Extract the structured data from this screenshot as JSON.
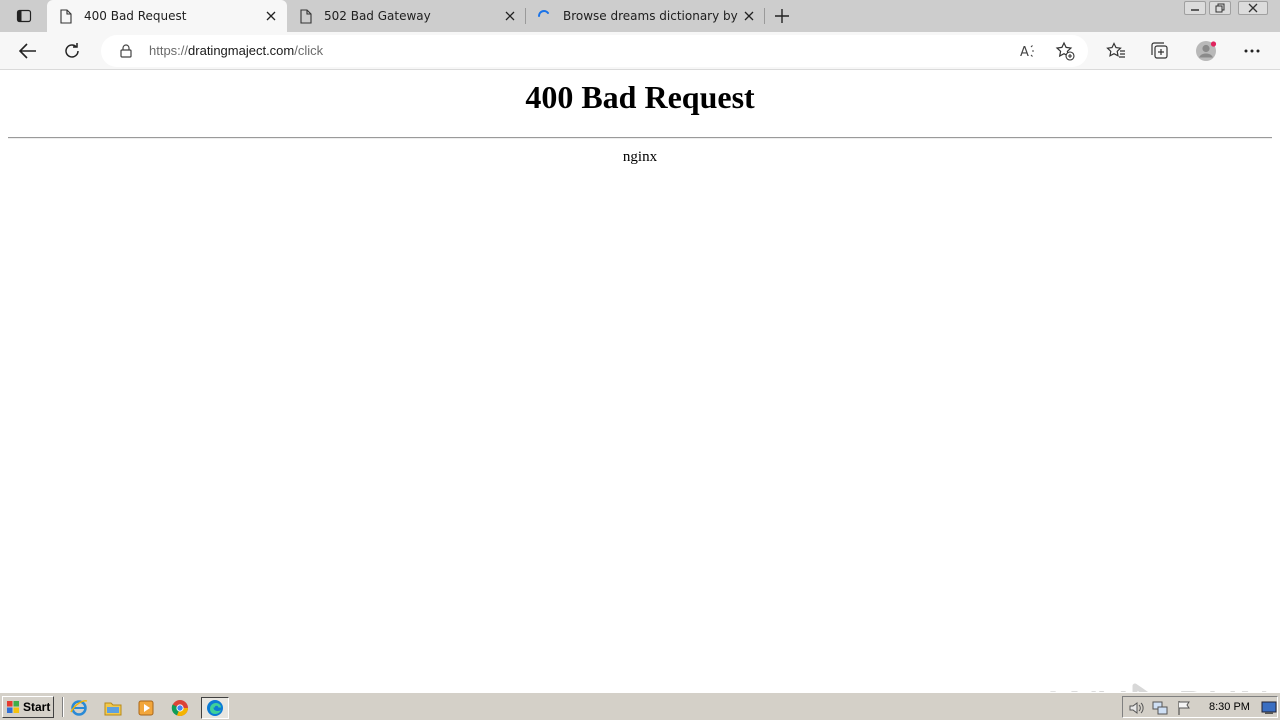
{
  "tabs": [
    {
      "title": "400 Bad Request",
      "active": true
    },
    {
      "title": "502 Bad Gateway",
      "active": false
    },
    {
      "title": "Browse dreams dictionary by sear",
      "active": false,
      "loading": true
    }
  ],
  "address_bar": {
    "scheme": "https://",
    "host": "dratingmaject.com",
    "path": "/click"
  },
  "page": {
    "heading": "400 Bad Request",
    "server": "nginx"
  },
  "watermark": {
    "left": "ANY",
    "right": "RUN"
  },
  "taskbar": {
    "start_label": "Start",
    "clock": "8:30 PM"
  },
  "icons": {
    "tab_actions": "tab-actions-icon",
    "page": "page-icon",
    "close": "close-icon",
    "spinner": "loading-spinner-icon",
    "new_tab": "plus-icon",
    "back": "back-arrow-icon",
    "refresh": "refresh-icon",
    "lock": "lock-icon",
    "read_aloud": "read-aloud-icon",
    "add_favorite": "star-add-icon",
    "favorites": "favorites-icon",
    "collections": "collections-icon",
    "profile": "profile-icon",
    "more": "more-icon"
  },
  "colors": {
    "tabstrip": "#cdcdcd",
    "toolbar": "#f7f7f7",
    "taskbar": "#d4d0c8",
    "spinner": "#1a73e8"
  }
}
